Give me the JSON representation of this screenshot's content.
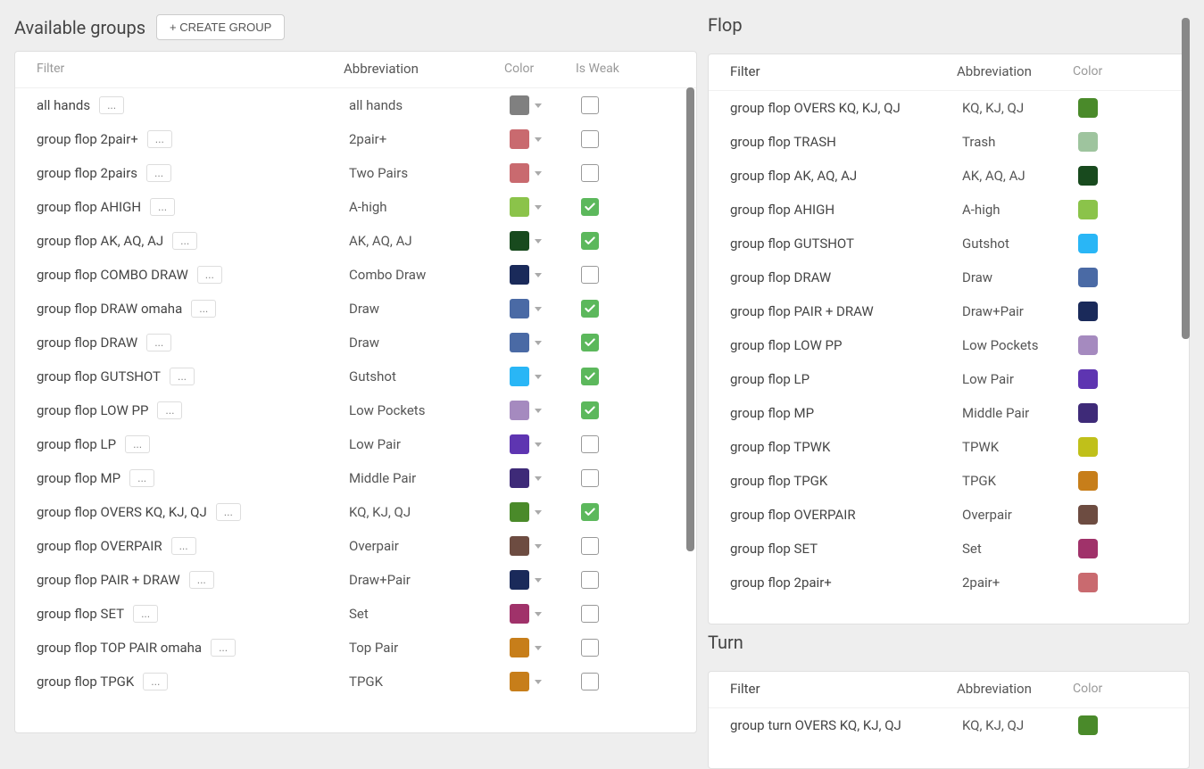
{
  "left": {
    "title": "Available groups",
    "create_button": "+ CREATE GROUP",
    "headers": {
      "filter": "Filter",
      "abbr": "Abbreviation",
      "color": "Color",
      "weak": "Is Weak"
    },
    "rows": [
      {
        "name": "all hands",
        "abbr": "all hands",
        "color": "#808080",
        "weak": false
      },
      {
        "name": "group flop 2pair+",
        "abbr": "2pair+",
        "color": "#c96a6f",
        "weak": false
      },
      {
        "name": "group flop 2pairs",
        "abbr": "Two Pairs",
        "color": "#c96a6f",
        "weak": false
      },
      {
        "name": "group flop AHIGH",
        "abbr": "A-high",
        "color": "#8bc34a",
        "weak": true
      },
      {
        "name": "group flop AK, AQ, AJ",
        "abbr": "AK, AQ, AJ",
        "color": "#184a1e",
        "weak": true
      },
      {
        "name": "group flop COMBO DRAW",
        "abbr": "Combo Draw",
        "color": "#1a2a5a",
        "weak": false
      },
      {
        "name": "group flop DRAW omaha",
        "abbr": "Draw",
        "color": "#4a6aa5",
        "weak": true
      },
      {
        "name": "group flop DRAW",
        "abbr": "Draw",
        "color": "#4a6aa5",
        "weak": true
      },
      {
        "name": "group flop GUTSHOT",
        "abbr": "Gutshot",
        "color": "#29b6f6",
        "weak": true
      },
      {
        "name": "group flop LOW PP",
        "abbr": "Low Pockets",
        "color": "#a58abf",
        "weak": true
      },
      {
        "name": "group flop LP",
        "abbr": "Low Pair",
        "color": "#5e35b1",
        "weak": false
      },
      {
        "name": "group flop MP",
        "abbr": "Middle Pair",
        "color": "#3e2a78",
        "weak": false
      },
      {
        "name": "group flop OVERS KQ, KJ, QJ",
        "abbr": "KQ, KJ, QJ",
        "color": "#4a8a2a",
        "weak": true
      },
      {
        "name": "group flop OVERPAIR",
        "abbr": "Overpair",
        "color": "#6d4c41",
        "weak": false
      },
      {
        "name": "group flop PAIR + DRAW",
        "abbr": "Draw+Pair",
        "color": "#1a2a5a",
        "weak": false
      },
      {
        "name": "group flop SET",
        "abbr": "Set",
        "color": "#a0326a",
        "weak": false
      },
      {
        "name": "group flop TOP PAIR omaha",
        "abbr": "Top Pair",
        "color": "#c77e1a",
        "weak": false
      },
      {
        "name": "group flop TPGK",
        "abbr": "TPGK",
        "color": "#c77e1a",
        "weak": false
      }
    ],
    "more": "..."
  },
  "right": {
    "flop": {
      "title": "Flop",
      "headers": {
        "filter": "Filter",
        "abbr": "Abbreviation",
        "color": "Color"
      },
      "rows": [
        {
          "name": "group flop OVERS KQ, KJ, QJ",
          "abbr": "KQ, KJ, QJ",
          "color": "#4a8a2a"
        },
        {
          "name": "group flop TRASH",
          "abbr": "Trash",
          "color": "#9ec49e"
        },
        {
          "name": "group flop AK, AQ, AJ",
          "abbr": "AK, AQ, AJ",
          "color": "#184a1e"
        },
        {
          "name": "group flop AHIGH",
          "abbr": "A-high",
          "color": "#8bc34a"
        },
        {
          "name": "group flop GUTSHOT",
          "abbr": "Gutshot",
          "color": "#29b6f6"
        },
        {
          "name": "group flop DRAW",
          "abbr": "Draw",
          "color": "#4a6aa5"
        },
        {
          "name": "group flop PAIR + DRAW",
          "abbr": "Draw+Pair",
          "color": "#1a2a5a"
        },
        {
          "name": "group flop LOW PP",
          "abbr": "Low Pockets",
          "color": "#a58abf"
        },
        {
          "name": "group flop LP",
          "abbr": "Low Pair",
          "color": "#5e35b1"
        },
        {
          "name": "group flop MP",
          "abbr": "Middle Pair",
          "color": "#3e2a78"
        },
        {
          "name": "group flop TPWK",
          "abbr": "TPWK",
          "color": "#c0c01a"
        },
        {
          "name": "group flop TPGK",
          "abbr": "TPGK",
          "color": "#c77e1a"
        },
        {
          "name": "group flop OVERPAIR",
          "abbr": "Overpair",
          "color": "#6d4c41"
        },
        {
          "name": "group flop SET",
          "abbr": "Set",
          "color": "#a0326a"
        },
        {
          "name": "group flop 2pair+",
          "abbr": "2pair+",
          "color": "#c96a6f"
        }
      ]
    },
    "turn": {
      "title": "Turn",
      "headers": {
        "filter": "Filter",
        "abbr": "Abbreviation",
        "color": "Color"
      },
      "rows": [
        {
          "name": "group turn OVERS KQ, KJ, QJ",
          "abbr": "KQ, KJ, QJ",
          "color": "#4a8a2a"
        }
      ]
    }
  }
}
